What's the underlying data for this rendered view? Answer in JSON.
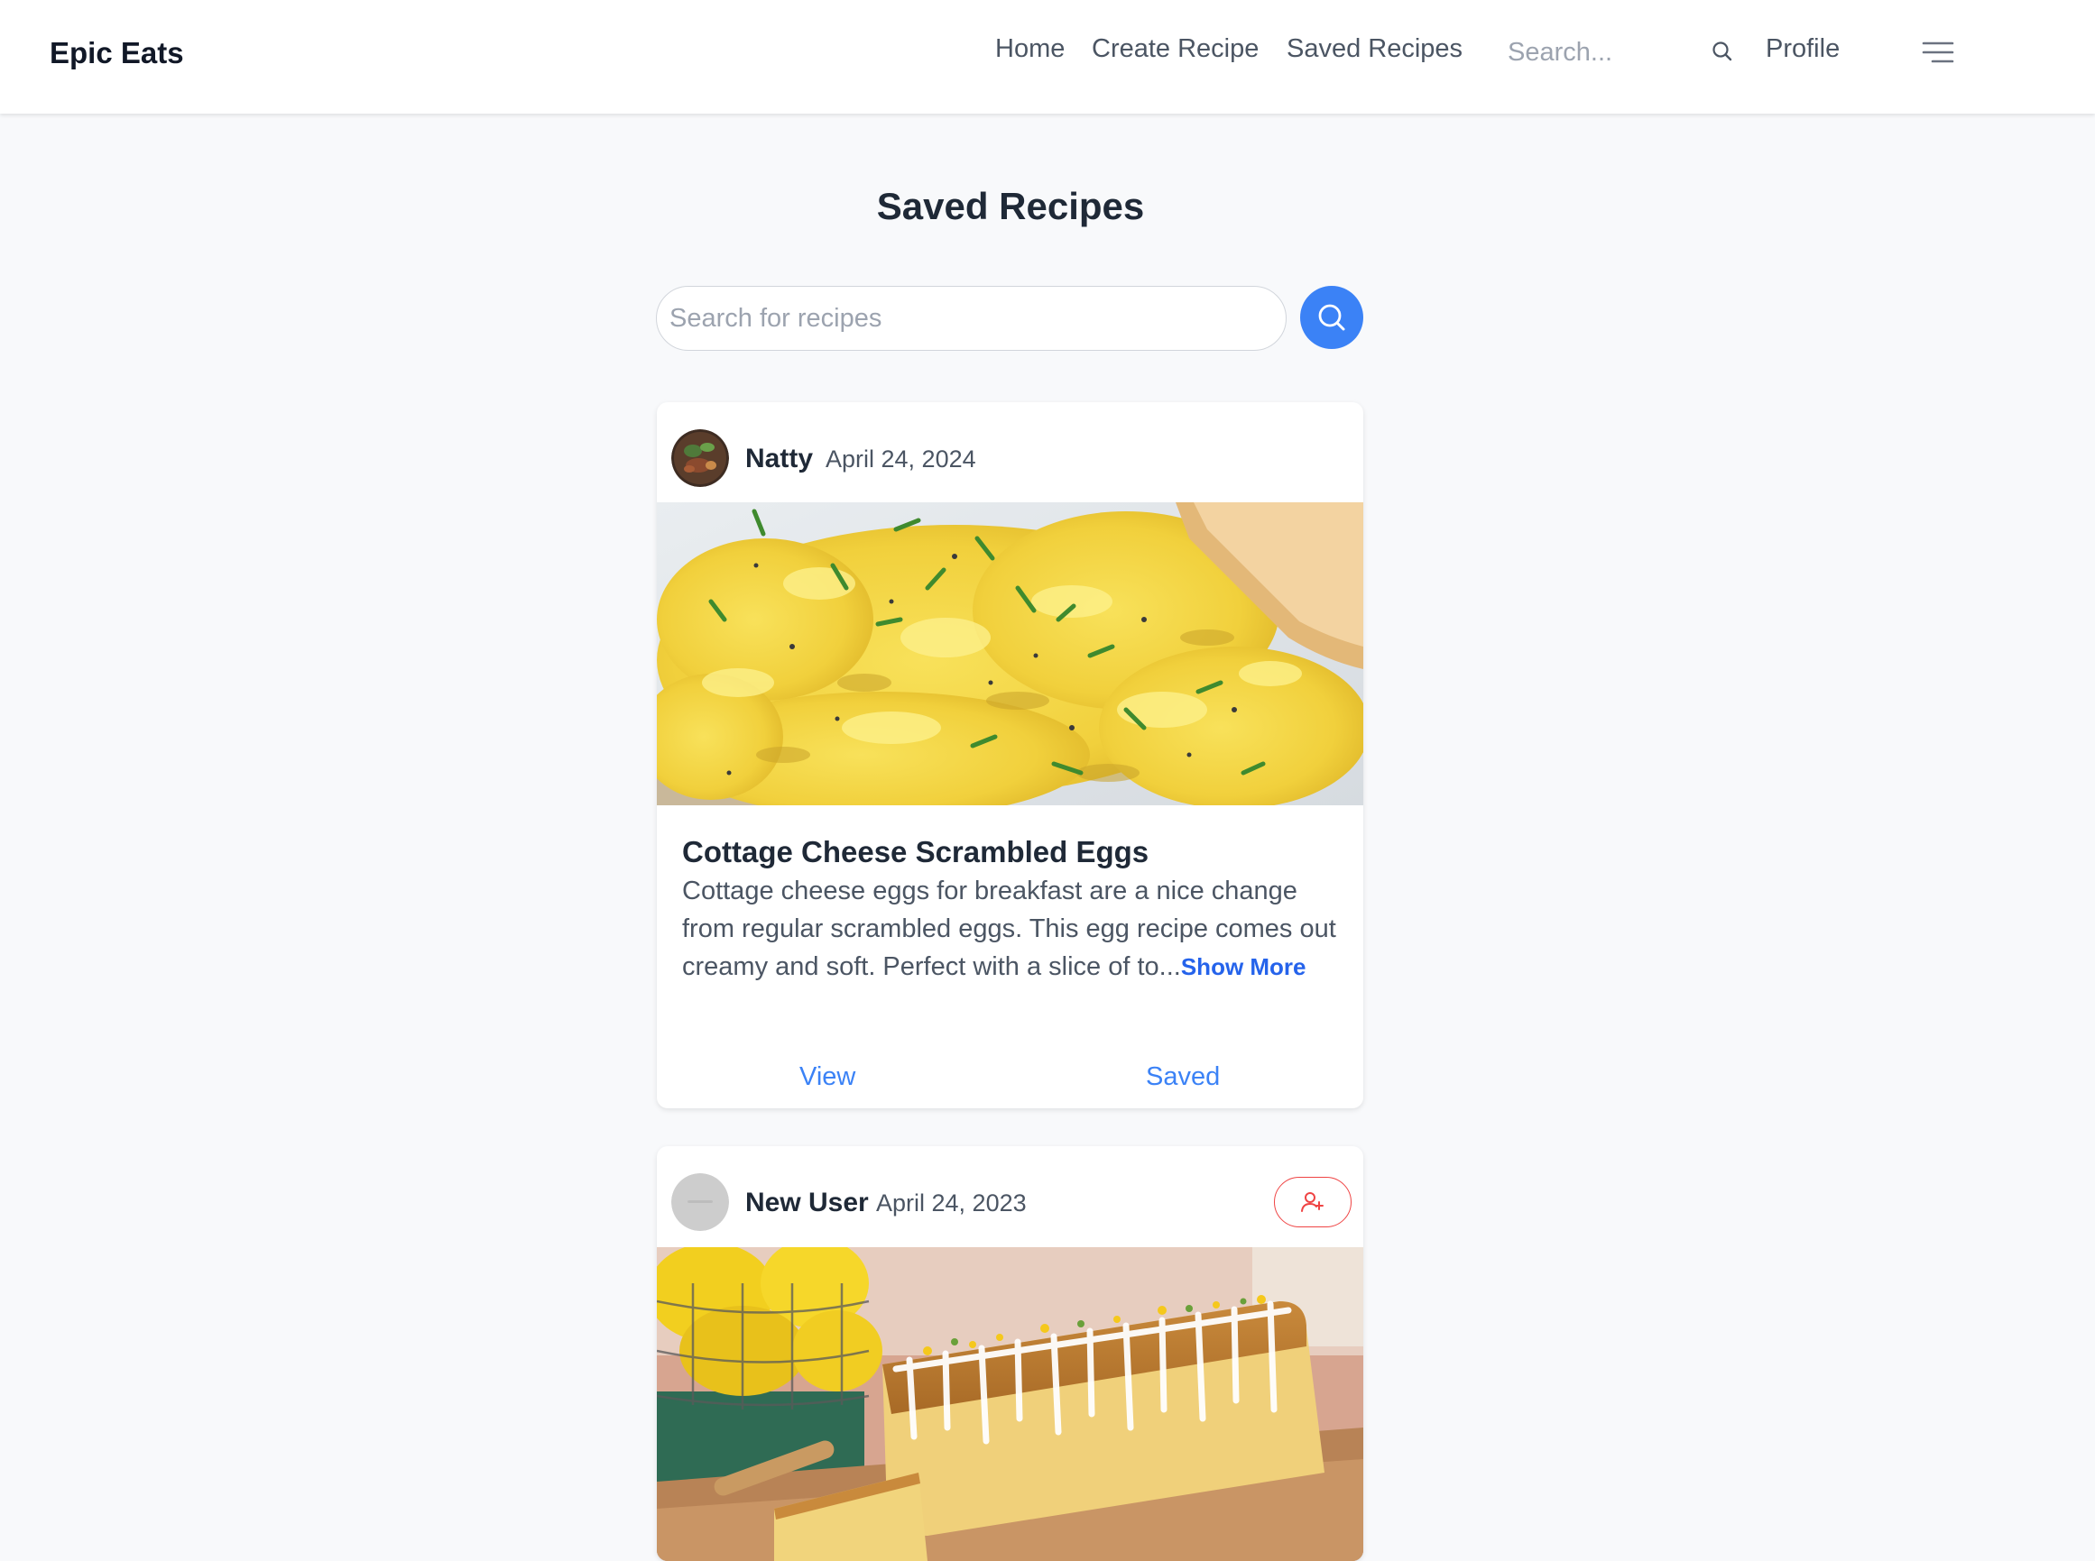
{
  "navbar": {
    "brand": "Epic Eats",
    "links": {
      "home": "Home",
      "create": "Create Recipe",
      "saved": "Saved Recipes"
    },
    "search_placeholder": "Search...",
    "search_icon": "search-icon",
    "profile": "Profile",
    "menu_icon": "menu-icon"
  },
  "page": {
    "title": "Saved Recipes",
    "search_placeholder": "Search for recipes",
    "search_button_icon": "search-icon"
  },
  "recipes": [
    {
      "author": "Natty",
      "date": "April 24, 2024",
      "title": "Cottage Cheese Scrambled Eggs",
      "description": "Cottage cheese eggs for breakfast are a nice change from regular scrambled eggs. This egg recipe comes out creamy and soft. Perfect with a slice of to...",
      "show_more": "Show More",
      "actions": {
        "view": "View",
        "saved": "Saved"
      }
    },
    {
      "author": "New User",
      "date": "April 24, 2023",
      "follow_icon": "add-user-icon"
    }
  ],
  "colors": {
    "accent": "#3b82f6",
    "link": "#2563eb",
    "follow": "#ef4444",
    "background": "#f8f9fb"
  }
}
